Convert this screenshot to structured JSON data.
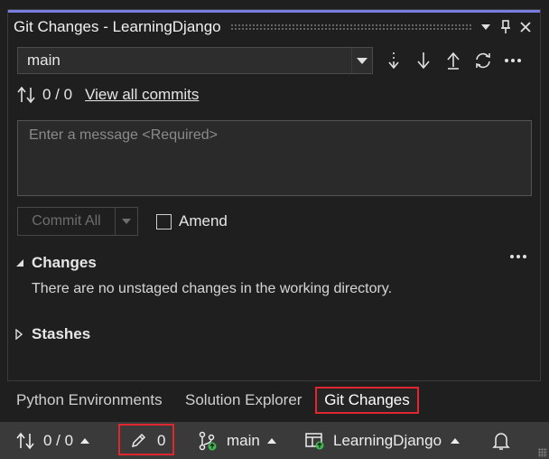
{
  "panel": {
    "title": "Git Changes - LearningDjango",
    "controls": {
      "dropdown_icon": "chevron-down-icon",
      "pin_icon": "pin-icon",
      "close_icon": "close-icon"
    }
  },
  "branch": {
    "current": "main",
    "actions": [
      "fetch-icon",
      "pull-icon",
      "push-icon",
      "sync-icon",
      "more-icon"
    ]
  },
  "commits": {
    "counts": "0 / 0",
    "view_all_label": "View all commits"
  },
  "message": {
    "placeholder": "Enter a message <Required>"
  },
  "commit": {
    "button_label": "Commit All",
    "amend_label": "Amend",
    "amend_checked": false
  },
  "changes": {
    "header": "Changes",
    "empty_text": "There are no unstaged changes in the working directory."
  },
  "stashes": {
    "header": "Stashes"
  },
  "tabs": [
    {
      "label": "Python Environments",
      "active": false
    },
    {
      "label": "Solution Explorer",
      "active": false
    },
    {
      "label": "Git Changes",
      "active": true
    }
  ],
  "statusbar": {
    "sync_counts": "0 / 0",
    "pending_changes": "0",
    "branch": "main",
    "repository": "LearningDjango"
  },
  "colors": {
    "accent": "#7a7ce0",
    "highlight_border": "#e0262e",
    "sync_badge": "#3fb950",
    "background": "#1f1f1f"
  }
}
